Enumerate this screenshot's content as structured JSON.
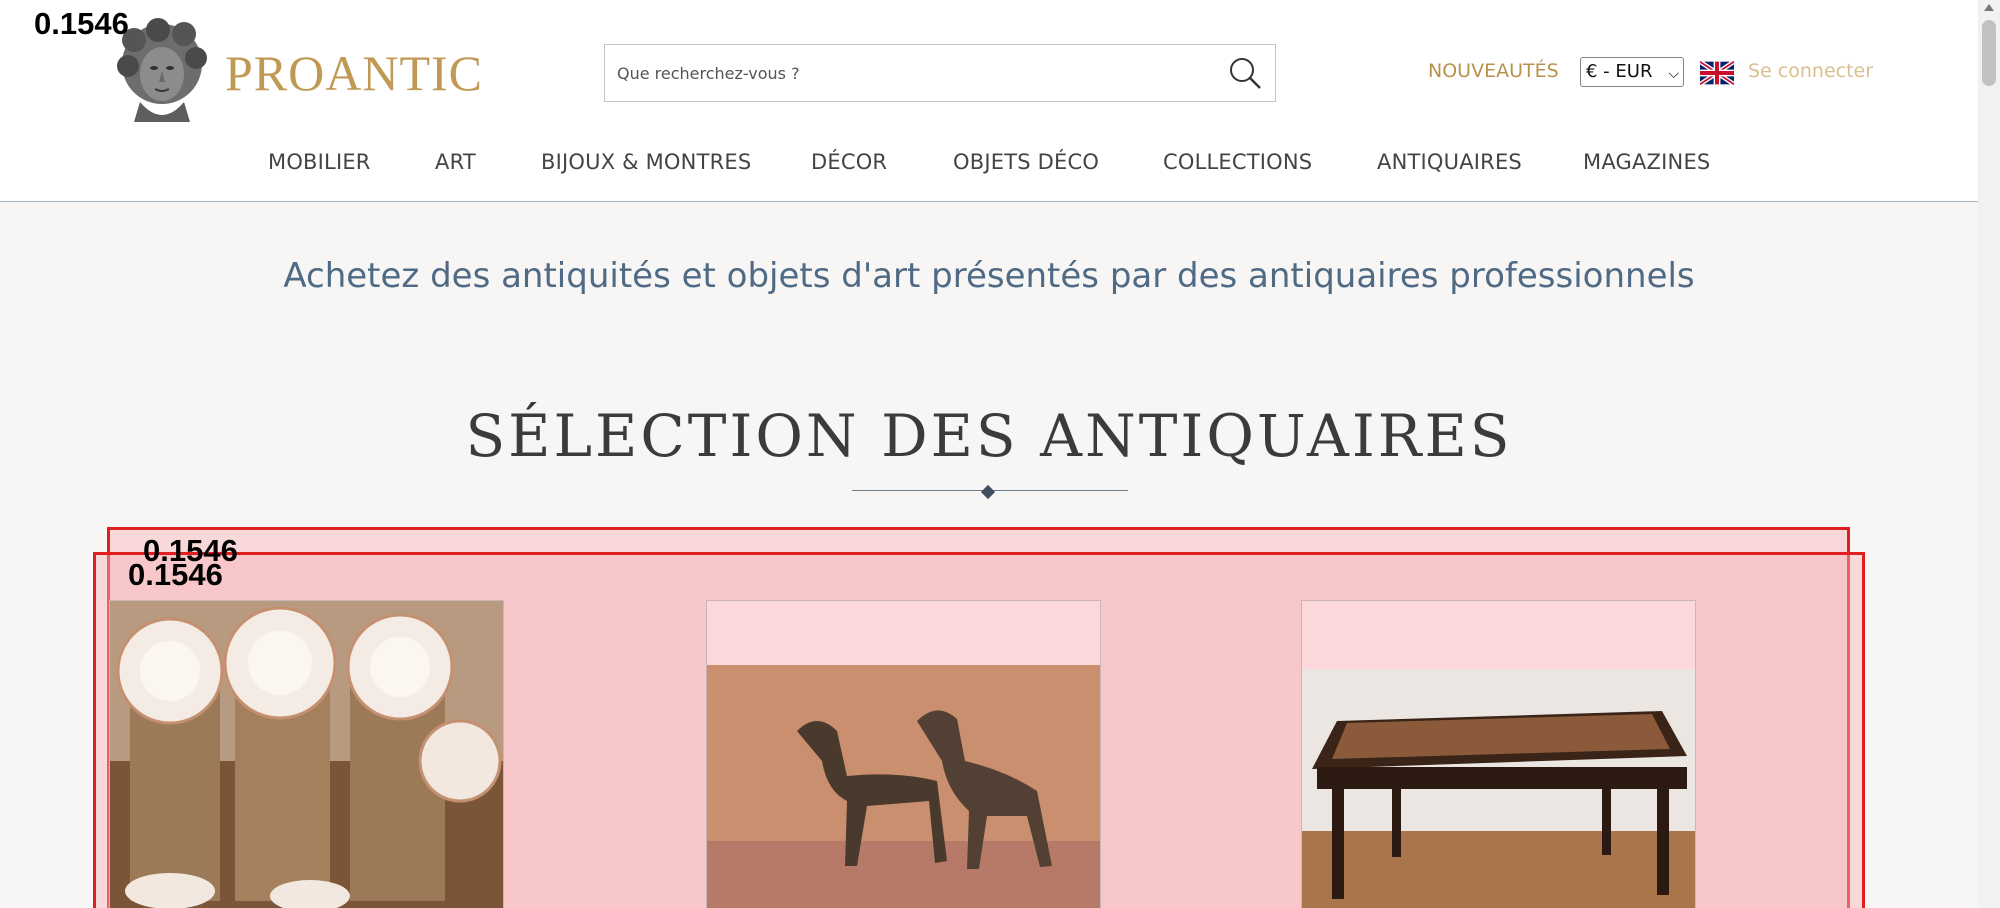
{
  "header": {
    "brand": "PROANTIC",
    "search": {
      "placeholder": "Que recherchez-vous ?"
    },
    "new_link": "NOUVEAUTÉS",
    "currency": "€ - EUR",
    "login": "Se connecter",
    "flag": "uk-flag-icon"
  },
  "nav": {
    "items": [
      "MOBILIER",
      "ART",
      "BIJOUX & MONTRES",
      "DÉCOR",
      "OBJETS DÉCO",
      "COLLECTIONS",
      "ANTIQUAIRES",
      "MAGAZINES"
    ]
  },
  "main": {
    "tagline": "Achetez des antiquités et objets d'art présentés par des antiquaires professionnels",
    "section_title": "SÉLECTION DES ANTIQUAIRES",
    "cards": [
      {
        "image": "porcelain-plates-photo"
      },
      {
        "image": "bronze-greyhounds-photo"
      },
      {
        "image": "writing-desk-photo"
      }
    ]
  },
  "overlay": {
    "scores": [
      "0.1546",
      "0.1546",
      "0.1546"
    ],
    "box_color": "#e02020"
  },
  "colors": {
    "brand_gold": "#c09a55",
    "tagline_blue": "#4e6a85",
    "background": "#f7f6f4"
  }
}
